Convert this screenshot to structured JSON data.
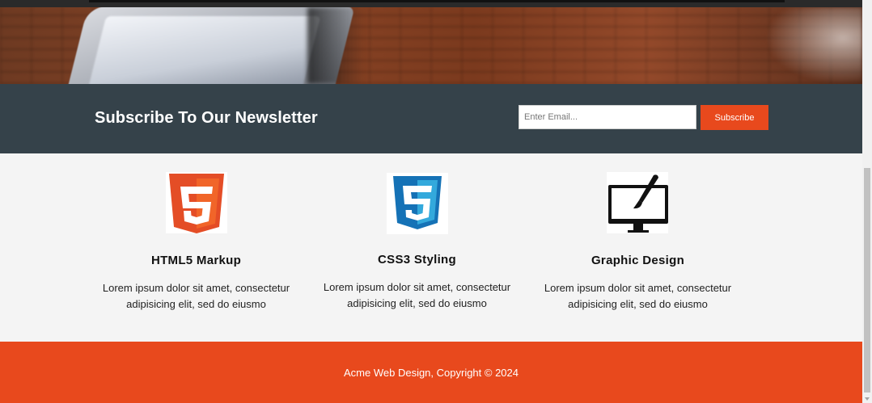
{
  "newsletter": {
    "heading": "Subscribe To Our Newsletter",
    "email_placeholder": "Enter Email...",
    "subscribe_label": "Subscribe"
  },
  "boxes": [
    {
      "icon": "html5-logo-icon",
      "title": "HTML5 Markup",
      "text_line1": "Lorem ipsum dolor sit amet, consectetur",
      "text_line2": "adipisicing elit, sed do eiusmo"
    },
    {
      "icon": "css3-logo-icon",
      "title": "CSS3 Styling",
      "text_line1": "Lorem ipsum dolor sit amet, consectetur",
      "text_line2": "adipisicing elit, sed do eiusmo"
    },
    {
      "icon": "monitor-brush-icon",
      "title": "Graphic Design",
      "text_line1": "Lorem ipsum dolor sit amet, consectetur",
      "text_line2": "adipisicing elit, sed do eiusmo"
    }
  ],
  "footer": {
    "copyright": "Acme Web Design, Copyright © 2024"
  },
  "colors": {
    "accent": "#e8491d",
    "newsletter_bg": "#35424a",
    "page_bg": "#f4f4f4",
    "html5_orange": "#e44d26",
    "css3_blue": "#1572b6"
  }
}
